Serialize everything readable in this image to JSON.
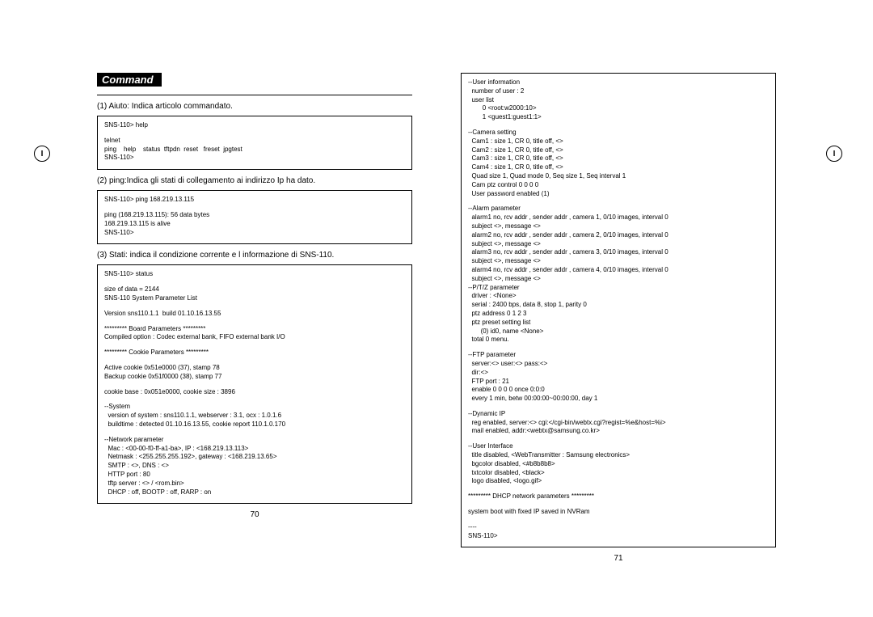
{
  "header": {
    "title": "Command"
  },
  "left": {
    "d1": "(1) Aiuto: Indica articolo commandato.",
    "box1": {
      "l1": "SNS-110> help",
      "l2": "telnet",
      "l3": "ping    help    status  tftpdn  reset   freset  jpgtest",
      "l4": "SNS-110>"
    },
    "d2": "(2) ping:Indica gli stati di collegamento ai indirizzo Ip ha dato.",
    "box2": {
      "l1": "SNS-110> ping 168.219.13.115",
      "l2": "ping (168.219.13.115): 56 data bytes",
      "l3": "168.219.13.115 is alive",
      "l4": "SNS-110>"
    },
    "d3": "(3) Stati: indica il condizione corrente e l informazione di SNS-110.",
    "box3": {
      "l1": "SNS-110> status",
      "l2": "size of data = 2144",
      "l3": "SNS-110 System Parameter List",
      "l4": "Version sns110.1.1  build 01.10.16.13.55",
      "l5": "********* Board Parameters *********",
      "l6": "Compiled option : Codec external bank, FIFO external bank I/O",
      "l7": "********* Cookie Parameters *********",
      "l8": "Active cookie 0x51e0000 (37), stamp 78",
      "l9": "Backup cookie 0x51f0000 (38), stamp 77",
      "l10": "cookie base : 0x051e0000, cookie size : 3896",
      "l11": "--System",
      "l12": "  version of system : sns110.1.1, webserver : 3.1, ocx : 1.0.1.6",
      "l13": "  buildtime : detected 01.10.16.13.55, cookie report 110.1.0.170",
      "l14": "--Network parameter",
      "l15": "  Mac : <00-00-f0-ff-a1-ba>, IP : <168.219.13.113>",
      "l16": "  Netmask : <255.255.255.192>, gateway : <168.219.13.65>",
      "l17": "  SMTP : <>, DNS : <>",
      "l18": "  HTTP port : 80",
      "l19": "  tftp server : <> / <rom.bin>",
      "l20": "  DHCP : off, BOOTP : off, RARP : on"
    },
    "pagenum": "70"
  },
  "right": {
    "box": {
      "l1": "--User information",
      "l2": "  number of user : 2",
      "l3": "  user list",
      "l4": "        0 <root:w2000:10>",
      "l5": "        1 <guest1:guest1:1>",
      "l6": "--Camera setting",
      "l7": "  Cam1 : size 1, CR 0, title off, <>",
      "l8": "  Cam2 : size 1, CR 0, title off, <>",
      "l9": "  Cam3 : size 1, CR 0, title off, <>",
      "l10": "  Cam4 : size 1, CR 0, title off, <>",
      "l11": "  Quad size 1, Quad mode 0, Seq size 1, Seq interval 1",
      "l12": "  Cam ptz control 0 0 0 0",
      "l13": "  User password enabled (1)",
      "l14": "--Alarm parameter",
      "l15": "  alarm1 no, rcv addr , sender addr , camera 1, 0/10 images, interval 0",
      "l16": "  subject <>, message <>",
      "l17": "  alarm2 no, rcv addr , sender addr , camera 2, 0/10 images, interval 0",
      "l18": "  subject <>, message <>",
      "l19": "  alarm3 no, rcv addr , sender addr , camera 3, 0/10 images, interval 0",
      "l20": "  subject <>, message <>",
      "l21": "  alarm4 no, rcv addr , sender addr , camera 4, 0/10 images, interval 0",
      "l22": "  subject <>, message <>",
      "l23": "--P/T/Z parameter",
      "l24": "  driver : <None>",
      "l25": "  serial : 2400 bps, data 8, stop 1, parity 0",
      "l26": "  ptz address 0 1 2 3",
      "l27": "  ptz preset setting list",
      "l28": "       (0) id0, name <None>",
      "l29": "  total 0 menu.",
      "l30": "--FTP parameter",
      "l31": "  server:<> user:<> pass:<>",
      "l32": "  dir:<>",
      "l33": "  FTP port : 21",
      "l34": "  enable 0 0 0 0 once 0:0:0",
      "l35": "  every 1 min, betw 00:00:00~00:00:00, day 1",
      "l36": "--Dynamic IP",
      "l37": "  reg enabled, server:<> cgi:</cgi-bin/webtx.cgi?regist=%e&host=%i>",
      "l38": "  mail enabled, addr:<webtx@samsung.co.kr>",
      "l39": "--User Interface",
      "l40": "  title disabled, <WebTransmitter : Samsung electronics>",
      "l41": "  bgcolor disabled, <#b8b8b8>",
      "l42": "  txtcolor disabled, <black>",
      "l43": "  logo disabled, <logo.gif>",
      "l44": "********* DHCP network parameters *********",
      "l45": "system boot with fixed IP saved in NVRam",
      "l46": "----",
      "l47": "SNS-110>"
    },
    "pagenum": "71"
  },
  "margin_icon": "I"
}
